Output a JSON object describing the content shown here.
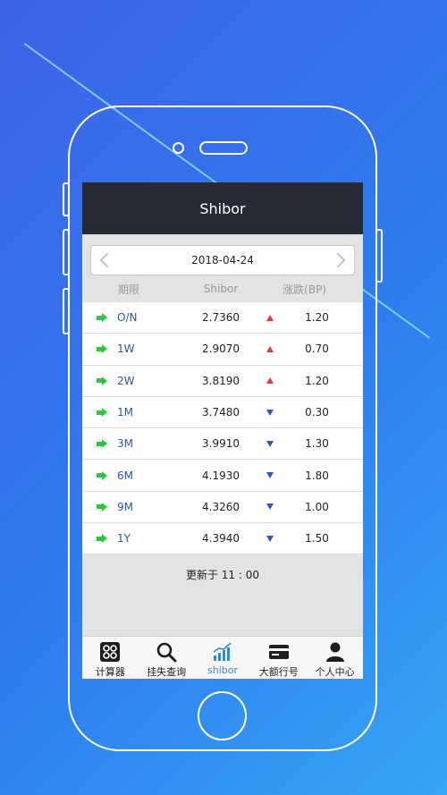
{
  "screen": {
    "title": "Shibor",
    "date": "2018-04-24",
    "columns": {
      "term": "期限",
      "rate": "Shibor",
      "change": "涨跌(BP)"
    },
    "rows": [
      {
        "term": "O/N",
        "rate": "2.7360",
        "dir": "up",
        "change": "1.20"
      },
      {
        "term": "1W",
        "rate": "2.9070",
        "dir": "up",
        "change": "0.70"
      },
      {
        "term": "2W",
        "rate": "3.8190",
        "dir": "up",
        "change": "1.20"
      },
      {
        "term": "1M",
        "rate": "3.7480",
        "dir": "down",
        "change": "0.30"
      },
      {
        "term": "3M",
        "rate": "3.9910",
        "dir": "down",
        "change": "1.30"
      },
      {
        "term": "6M",
        "rate": "4.1930",
        "dir": "down",
        "change": "1.80"
      },
      {
        "term": "9M",
        "rate": "4.3260",
        "dir": "down",
        "change": "1.00"
      },
      {
        "term": "1Y",
        "rate": "4.3940",
        "dir": "down",
        "change": "1.50"
      }
    ],
    "update_text": "更新于 11 : 00"
  },
  "tabs": [
    {
      "label": "计算器",
      "icon": "calculator-icon"
    },
    {
      "label": "挂失查询",
      "icon": "search-icon"
    },
    {
      "label": "shibor",
      "icon": "chart-icon",
      "active": true
    },
    {
      "label": "大额行号",
      "icon": "card-icon"
    },
    {
      "label": "个人中心",
      "icon": "person-icon"
    }
  ],
  "colors": {
    "up": "#e03a3a",
    "down": "#2a56c8",
    "accent": "#2f8ad8",
    "arrow": "#2fc63d"
  }
}
